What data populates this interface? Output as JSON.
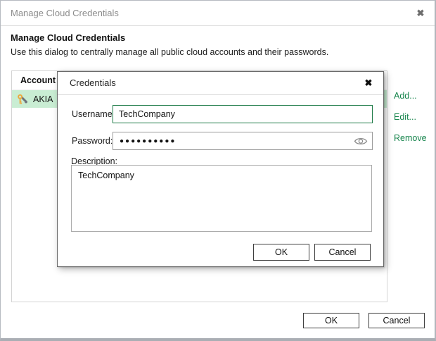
{
  "window": {
    "title": "Manage Cloud Credentials",
    "close_icon": "✖",
    "heading": "Manage Cloud Credentials",
    "subtitle": "Use this dialog to centrally manage all public cloud accounts and their passwords.",
    "table": {
      "header": "Account",
      "rows": [
        {
          "icon": "keys-icon",
          "account": "AKIA"
        }
      ]
    },
    "actions": [
      {
        "label": "Add..."
      },
      {
        "label": "Edit..."
      },
      {
        "label": "Remove"
      }
    ],
    "ok_label": "OK",
    "cancel_label": "Cancel"
  },
  "modal": {
    "title": "Credentials",
    "close_icon": "✖",
    "username_label": "Username:",
    "username_value": "TechCompany",
    "password_label": "Password:",
    "password_value": "●●●●●●●●●●",
    "description_label": "Description:",
    "description_value": "TechCompany",
    "ok_label": "OK",
    "cancel_label": "Cancel"
  },
  "colors": {
    "accent_green": "#17854d",
    "focus_border_green": "#1d7a47",
    "selected_row_green": "#c9edd3"
  }
}
